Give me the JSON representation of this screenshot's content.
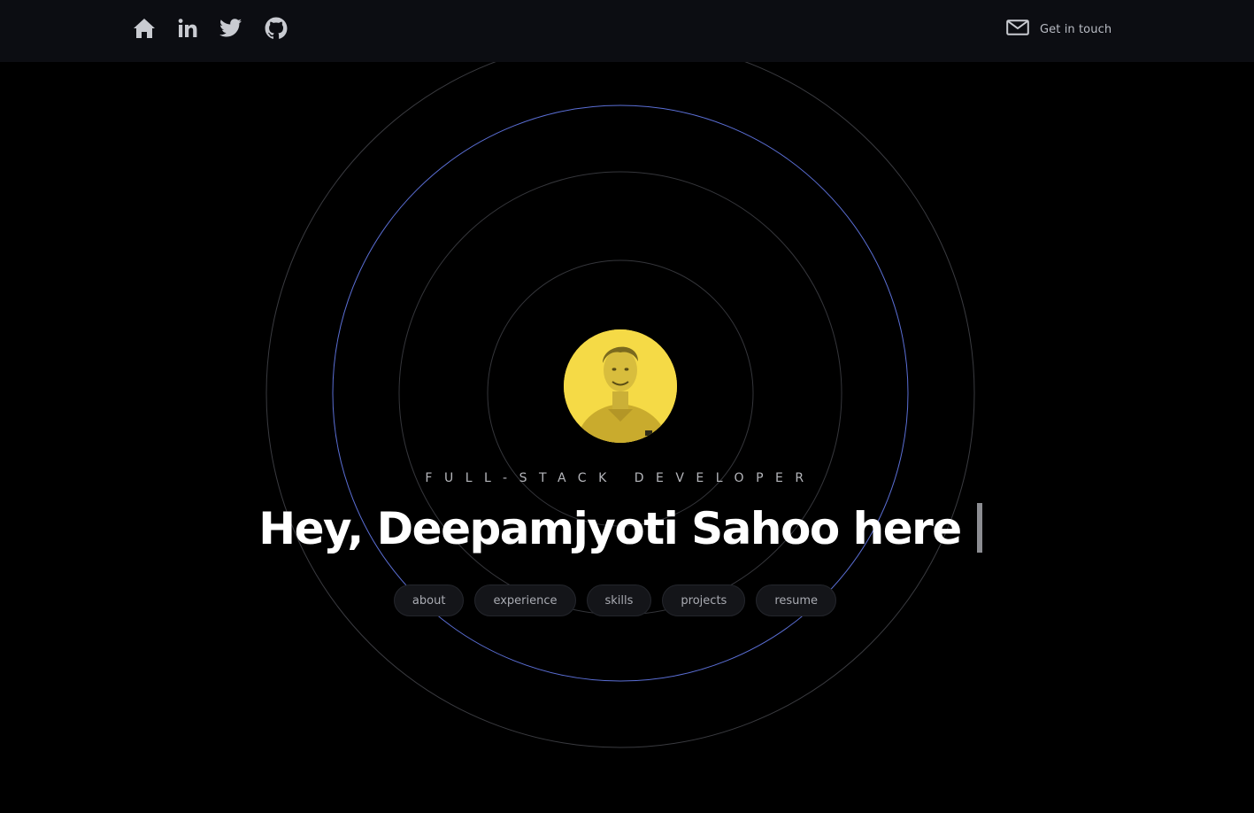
{
  "nav": {
    "icons": [
      "home-icon",
      "linkedin-icon",
      "twitter-icon",
      "github-icon"
    ],
    "contact_icon": "mail-icon",
    "contact_label": "Get in touch"
  },
  "hero": {
    "subtitle": "FULL-STACK DEVELOPER",
    "headline": "Hey, Deepamjyoti Sahoo here",
    "avatar_icon": "profile-photo",
    "links": [
      "about",
      "experience",
      "skills",
      "projects",
      "resume"
    ]
  },
  "colors": {
    "background": "#000000",
    "header": "#0c0d12",
    "accent_ring": "#5b6fd6",
    "avatar_bg": "#f5da46",
    "text": "#ffffff"
  }
}
